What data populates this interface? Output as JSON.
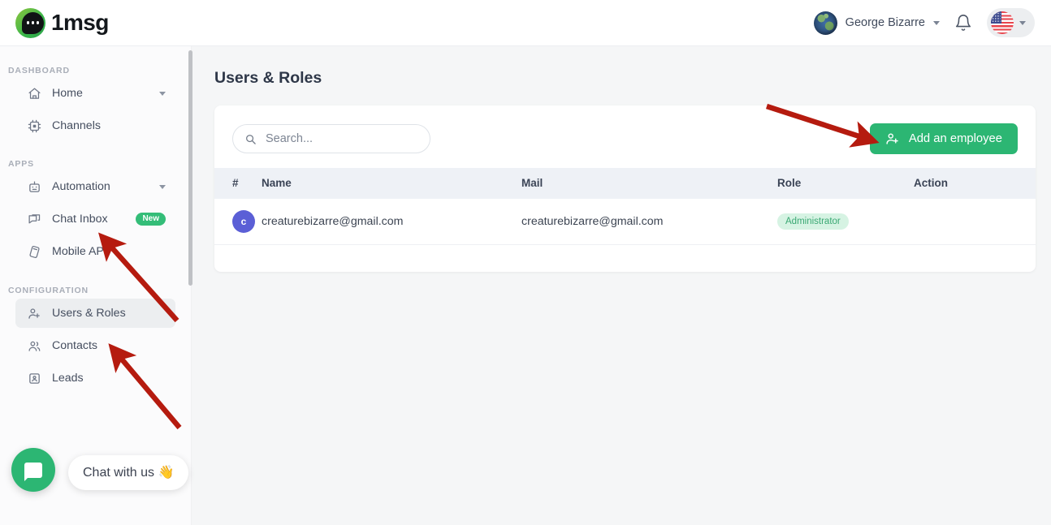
{
  "header": {
    "brand": "1msg",
    "user_name": "George Bizarre",
    "bell_icon": "bell-icon",
    "flag_icon": "us-flag-icon",
    "avatar_icon": "globe-avatar"
  },
  "sidebar": {
    "sections": [
      {
        "title": "DASHBOARD",
        "items": [
          {
            "label": "Home",
            "icon": "home-icon",
            "chevron": true,
            "badge": null,
            "active": false
          },
          {
            "label": "Channels",
            "icon": "chip-icon",
            "chevron": false,
            "badge": null,
            "active": false
          }
        ]
      },
      {
        "title": "APPS",
        "items": [
          {
            "label": "Automation",
            "icon": "robot-icon",
            "chevron": true,
            "badge": null,
            "active": false
          },
          {
            "label": "Chat Inbox",
            "icon": "chat-bubbles-icon",
            "chevron": false,
            "badge": "New",
            "active": false
          },
          {
            "label": "Mobile APP",
            "icon": "mobile-app-icon",
            "chevron": false,
            "badge": null,
            "active": false
          }
        ]
      },
      {
        "title": "CONFIGURATION",
        "items": [
          {
            "label": "Users & Roles",
            "icon": "user-plus-icon",
            "chevron": false,
            "badge": null,
            "active": true
          },
          {
            "label": "Contacts",
            "icon": "users-icon",
            "chevron": false,
            "badge": null,
            "active": false
          },
          {
            "label": "Leads",
            "icon": "lead-icon",
            "chevron": false,
            "badge": null,
            "active": false
          }
        ]
      }
    ]
  },
  "chat_widget": {
    "icon": "chat-bubble-icon",
    "tooltip": "Chat with us 👋"
  },
  "main": {
    "page_title": "Users & Roles",
    "search": {
      "value": "",
      "placeholder": "Search...",
      "icon": "search-icon"
    },
    "add_button": {
      "label": "Add an employee",
      "icon": "user-plus-icon"
    },
    "table": {
      "columns": [
        "#",
        "Name",
        "Mail",
        "Role",
        "Action"
      ],
      "rows": [
        {
          "avatar_letter": "c",
          "name": "creaturebizarre@gmail.com",
          "mail": "creaturebizarre@gmail.com",
          "role": "Administrator",
          "action": ""
        }
      ]
    }
  },
  "colors": {
    "accent_green": "#2cb673",
    "badge_green_bg": "#d6f3e3",
    "badge_green_text": "#3aa873",
    "new_badge": "#34bd78",
    "annotation_red": "#b51b0f",
    "avatar_blue": "#5b5fd6",
    "page_bg": "#f5f6f7",
    "sidebar_bg": "#fbfbfc",
    "table_head_bg": "#eef1f6"
  }
}
